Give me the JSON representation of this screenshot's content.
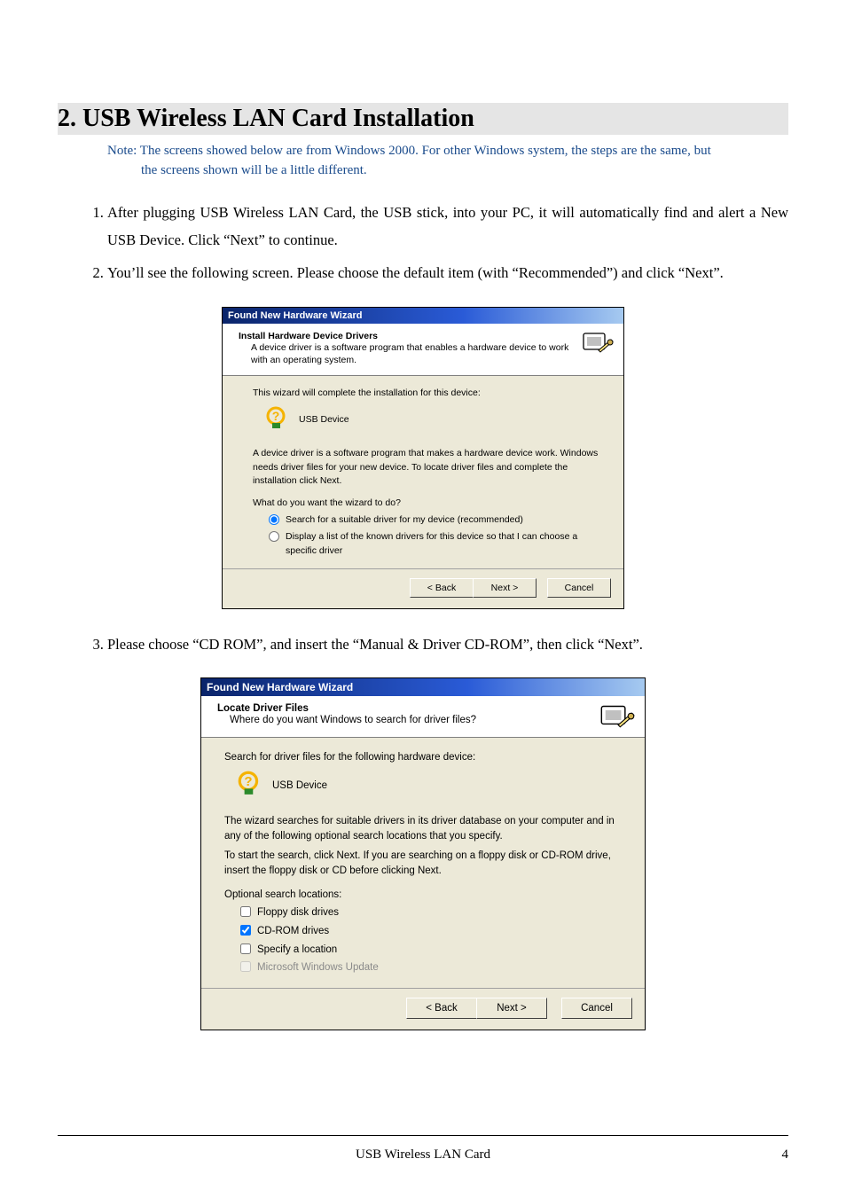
{
  "heading": "2. USB Wireless LAN Card Installation",
  "note_lead": "Note: The screens showed below are from Windows 2000. For other Windows system, the steps are the same, but",
  "note_cont": "the screens shown will be a little different.",
  "steps": {
    "1": "After plugging USB Wireless LAN Card, the USB stick, into your PC, it will automatically find and alert a New USB Device. Click “Next” to continue.",
    "2": "You’ll see the following screen. Please choose the default item (with “Recommended”) and click “Next”.",
    "3": "Please choose “CD ROM”, and insert the “Manual & Driver CD-ROM”, then click “Next”."
  },
  "wiz1": {
    "title": "Found New Hardware Wizard",
    "hdr_t": "Install Hardware Device Drivers",
    "hdr_s": "A device driver is a software program that enables a hardware device to work with an operating system.",
    "p1": "This wizard will complete the installation for this device:",
    "dev": "USB Device",
    "p2": "A device driver is a software program that makes a hardware device work. Windows needs driver files for your new device. To locate driver files and complete the installation click Next.",
    "q": "What do you want the wizard to do?",
    "opt1": "Search for a suitable driver for my device (recommended)",
    "opt2": "Display a list of the known drivers for this device so that I can choose a specific driver",
    "back": "< Back",
    "next": "Next >",
    "cancel": "Cancel"
  },
  "wiz2": {
    "title": "Found New Hardware Wizard",
    "hdr_t": "Locate Driver Files",
    "hdr_s": "Where do you want Windows to search for driver files?",
    "p1": "Search for driver files for the following hardware device:",
    "dev": "USB Device",
    "p2": "The wizard searches for suitable drivers in its driver database on your computer and in any of the following optional search locations that you specify.",
    "p3": "To start the search, click Next. If you are searching on a floppy disk or CD-ROM drive, insert the floppy disk or CD before clicking Next.",
    "optlbl": "Optional search locations:",
    "c1": "Floppy disk drives",
    "c2": "CD-ROM drives",
    "c3": "Specify a location",
    "c4": "Microsoft Windows Update",
    "back": "< Back",
    "next": "Next >",
    "cancel": "Cancel"
  },
  "footer_title": "USB Wireless LAN Card",
  "page_no": "4"
}
